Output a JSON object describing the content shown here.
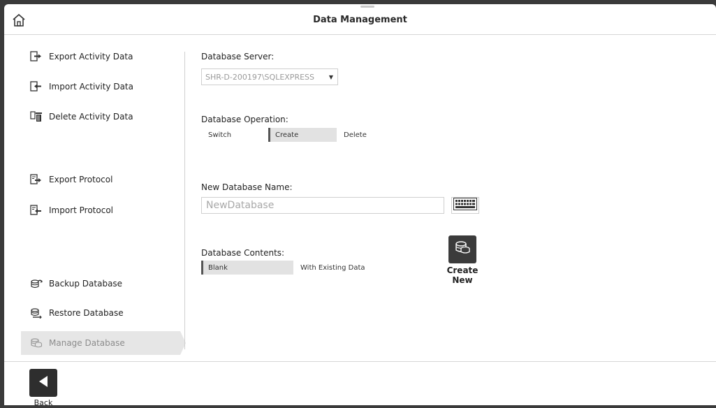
{
  "app": {
    "title": "Data Management"
  },
  "sidebar": {
    "items": [
      {
        "label": "Export Activity Data",
        "icon": "export-file-icon"
      },
      {
        "label": "Import Activity Data",
        "icon": "import-file-icon"
      },
      {
        "label": "Delete Activity Data",
        "icon": "trash-icon"
      },
      {
        "label": "Export Protocol",
        "icon": "export-protocol-icon"
      },
      {
        "label": "Import Protocol",
        "icon": "import-protocol-icon"
      },
      {
        "label": "Backup Database",
        "icon": "backup-database-icon"
      },
      {
        "label": "Restore Database",
        "icon": "restore-database-icon"
      },
      {
        "label": "Manage Database",
        "icon": "database-icon",
        "active": true
      }
    ]
  },
  "server": {
    "label": "Database Server:",
    "value": "SHR-D-200197\\SQLEXPRESS"
  },
  "operation": {
    "label": "Database Operation:",
    "options": [
      "Switch",
      "Create",
      "Delete"
    ],
    "selected": "Create"
  },
  "new_name": {
    "label": "New Database Name:",
    "placeholder": "NewDatabase"
  },
  "contents": {
    "label": "Database Contents:",
    "options": [
      "Blank",
      "With Existing Data"
    ],
    "selected": "Blank"
  },
  "actions": {
    "create_label": "Create New",
    "back_label": "Back"
  },
  "colors": {
    "accent": "#3b3b3b",
    "selected_bg": "#e2e2e2"
  }
}
